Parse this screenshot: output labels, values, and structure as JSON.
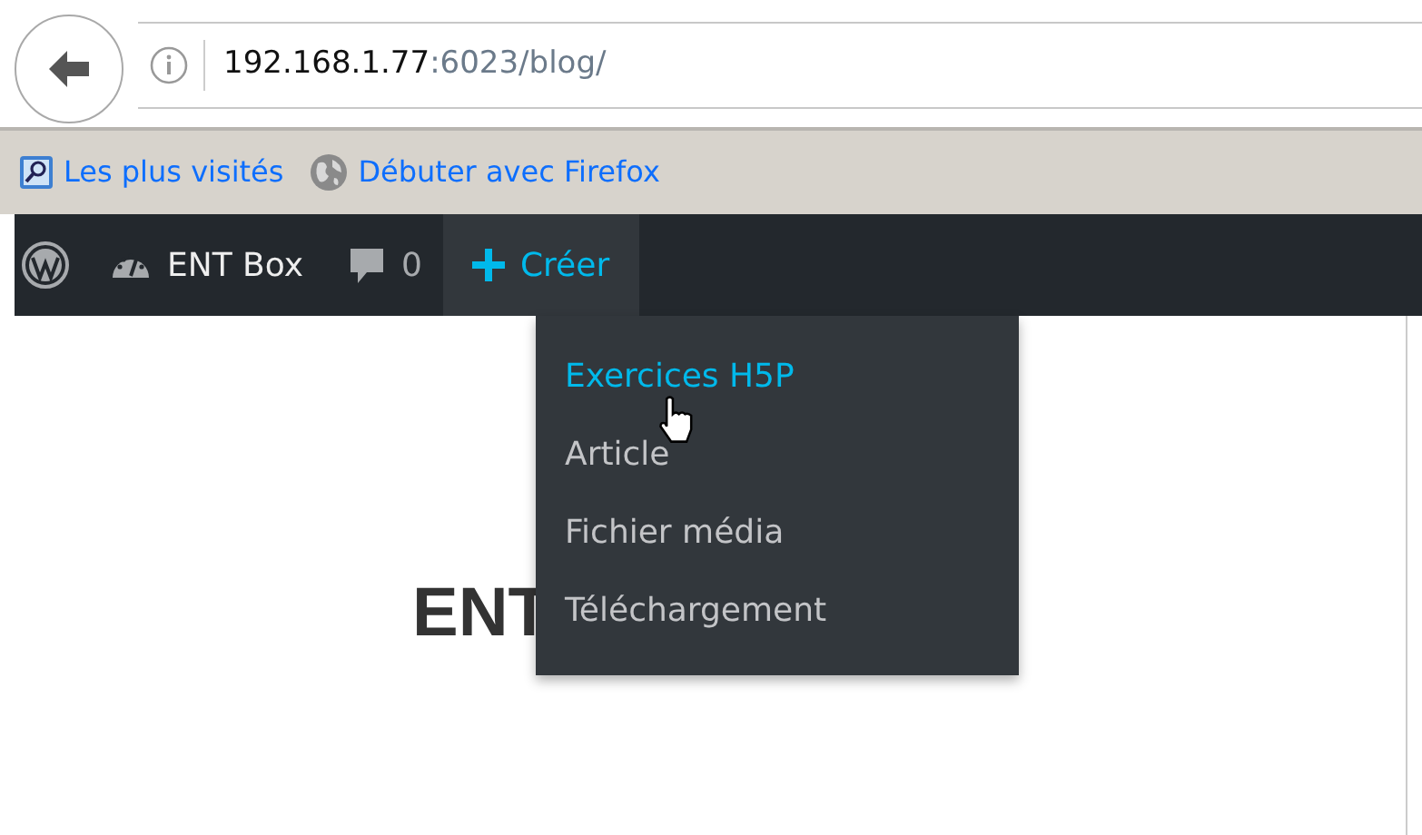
{
  "address_bar": {
    "host": "192.168.1.77",
    "path": ":6023/blog/"
  },
  "bookmarks": [
    {
      "label": "Les plus visités",
      "kind": "search"
    },
    {
      "label": "Débuter avec Firefox",
      "kind": "globe"
    }
  ],
  "admin_bar": {
    "site_name": "ENT Box",
    "comments_count": "0",
    "new_label": "Créer",
    "new_open": true
  },
  "new_menu": [
    {
      "label": "Exercices H5P",
      "selected": true
    },
    {
      "label": "Article",
      "selected": false
    },
    {
      "label": "Fichier média",
      "selected": false
    },
    {
      "label": "Téléchargement",
      "selected": false
    }
  ],
  "page": {
    "heading": "ENT"
  }
}
